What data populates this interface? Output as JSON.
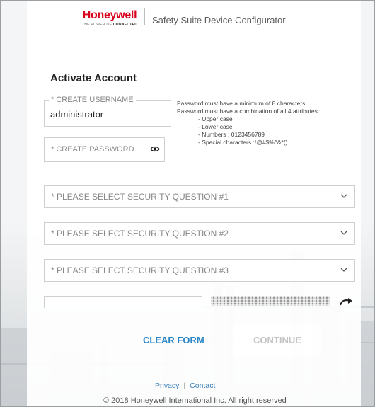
{
  "header": {
    "brand_name": "Honeywell",
    "brand_tag_prefix": "THE POWER OF",
    "brand_tag_bold": "CONNECTED",
    "app_title": "Safety Suite Device Configurator"
  },
  "form": {
    "title": "Activate Account",
    "username": {
      "label": "* CREATE USERNAME",
      "value": "administrator"
    },
    "password": {
      "placeholder": "* CREATE PASSWORD",
      "icon": "eye-icon"
    },
    "rules": {
      "line1": "Password must have a minimum of 8 characters.",
      "line2": "Password must have a combination of all 4 attributes:",
      "items": [
        "- Upper case",
        "- Lower case",
        "- Numbers : 0123456789",
        "- Special characters :!@#$%^&*()"
      ]
    },
    "questions": [
      "* PLEASE SELECT SECURITY QUESTION #1",
      "* PLEASE SELECT SECURITY QUESTION #2",
      "* PLEASE SELECT SECURITY QUESTION #3"
    ]
  },
  "actions": {
    "clear": "CLEAR FORM",
    "continue": "CONTINUE"
  },
  "footer": {
    "privacy": "Privacy",
    "separator": "|",
    "contact": "Contact",
    "copyright": "© 2018 Honeywell International Inc. All right reserved"
  },
  "colors": {
    "brand_red": "#d9001b",
    "link_blue": "#2a86c6",
    "disabled": "#c5c5c5"
  }
}
